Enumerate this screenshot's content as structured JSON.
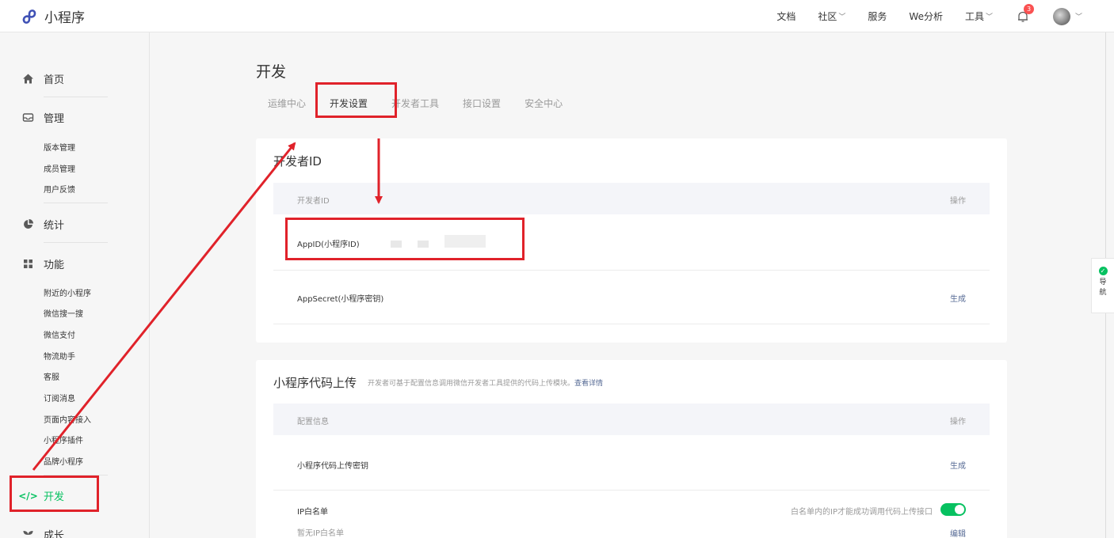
{
  "header": {
    "app_name": "小程序",
    "nav": [
      {
        "label": "文档",
        "has_dropdown": false
      },
      {
        "label": "社区",
        "has_dropdown": true
      },
      {
        "label": "服务",
        "has_dropdown": false
      },
      {
        "label": "We分析",
        "has_dropdown": false
      },
      {
        "label": "工具",
        "has_dropdown": true
      }
    ],
    "notification_count": "3"
  },
  "sidebar": {
    "home": "首页",
    "manage": "管理",
    "manage_items": [
      "版本管理",
      "成员管理",
      "用户反馈"
    ],
    "stats": "统计",
    "features": "功能",
    "feature_items": [
      "附近的小程序",
      "微信搜一搜",
      "微信支付",
      "物流助手",
      "客服",
      "订阅消息",
      "页面内容接入",
      "小程序插件",
      "品牌小程序"
    ],
    "develop": "开发",
    "growth": "成长"
  },
  "main": {
    "title": "开发",
    "tabs": [
      "运维中心",
      "开发设置",
      "开发者工具",
      "接口设置",
      "安全中心"
    ],
    "active_tab": "开发设置",
    "developer_id": {
      "title": "开发者ID",
      "header_left": "开发者ID",
      "header_right": "操作",
      "appid_label": "AppID(小程序ID)",
      "appsecret_label": "AppSecret(小程序密钥)",
      "appsecret_action": "生成"
    },
    "upload": {
      "title": "小程序代码上传",
      "desc": "开发者可基于配置信息调用微信开发者工具提供的代码上传模块。",
      "desc_link": "查看详情",
      "header_left": "配置信息",
      "header_right": "操作",
      "key_label": "小程序代码上传密钥",
      "key_action": "生成",
      "ip_label": "IP白名单",
      "ip_sub": "暂无IP白名单",
      "ip_switch_label": "白名单内的IP才能成功调用代码上传接口",
      "ip_action": "编辑"
    }
  },
  "floating": {
    "label": "导航"
  },
  "colors": {
    "accent": "#07c160",
    "link": "#576b95",
    "annotation": "#e0222a"
  }
}
